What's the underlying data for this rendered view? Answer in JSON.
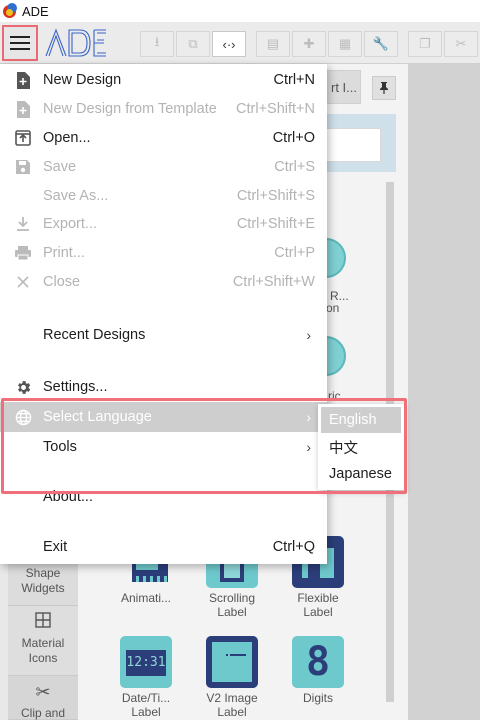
{
  "app": {
    "title": "ADE"
  },
  "toolbar": {
    "menu_icon": "hamburger-icon",
    "logo_text": "ADE",
    "buttons": [
      {
        "name": "download-icon",
        "glyph": "⭳"
      },
      {
        "name": "preview-icon",
        "glyph": "⧉"
      },
      {
        "name": "code-icon",
        "glyph": "‹·›"
      },
      {
        "name": "layers-icon",
        "glyph": "▤"
      },
      {
        "name": "puzzle-icon",
        "glyph": "✚"
      },
      {
        "name": "grid-icon",
        "glyph": "▦"
      },
      {
        "name": "wrench-icon",
        "glyph": "🔧"
      },
      {
        "name": "copy-icon",
        "glyph": "❐"
      },
      {
        "name": "scissors-icon",
        "glyph": "✂"
      }
    ]
  },
  "panel": {
    "tab_label": "rt I...",
    "pin_icon": "pin-icon"
  },
  "menu": {
    "items": [
      {
        "label": "New Design",
        "shortcut": "Ctrl+N",
        "icon": "new-file-icon",
        "enabled": true
      },
      {
        "label": "New Design from Template",
        "shortcut": "Ctrl+Shift+N",
        "icon": "template-icon",
        "enabled": false
      },
      {
        "label": "Open...",
        "shortcut": "Ctrl+O",
        "icon": "open-icon",
        "enabled": true
      },
      {
        "label": "Save",
        "shortcut": "Ctrl+S",
        "icon": "save-icon",
        "enabled": false
      },
      {
        "label": "Save As...",
        "shortcut": "Ctrl+Shift+S",
        "icon": "",
        "enabled": false
      },
      {
        "label": "Export...",
        "shortcut": "Ctrl+Shift+E",
        "icon": "export-icon",
        "enabled": false
      },
      {
        "label": "Print...",
        "shortcut": "Ctrl+P",
        "icon": "print-icon",
        "enabled": false
      },
      {
        "label": "Close",
        "shortcut": "Ctrl+Shift+W",
        "icon": "close-icon",
        "enabled": false
      },
      {
        "label": "Recent Designs",
        "shortcut": "",
        "icon": "",
        "enabled": true,
        "submenu": true
      },
      {
        "label": "Settings...",
        "shortcut": "",
        "icon": "gear-icon",
        "enabled": true
      },
      {
        "label": "Select Language",
        "shortcut": "",
        "icon": "globe-icon",
        "enabled": true,
        "submenu": true,
        "highlighted": true
      },
      {
        "label": "Tools",
        "shortcut": "",
        "icon": "",
        "enabled": true,
        "submenu": true
      },
      {
        "label": "About...",
        "shortcut": "",
        "icon": "",
        "enabled": true
      },
      {
        "label": "Exit",
        "shortcut": "Ctrl+Q",
        "icon": "",
        "enabled": true
      }
    ]
  },
  "language_menu": {
    "options": [
      "English",
      "中文",
      "Japanese"
    ],
    "selected": "English"
  },
  "categories": [
    {
      "label_line1": "Shape",
      "label_line2": "Widgets",
      "icon": "shape-icon"
    },
    {
      "label_line1": "Material",
      "label_line2": "Icons",
      "icon": "material-grid-icon"
    },
    {
      "label_line1": "Clip and",
      "label_line2": "",
      "icon": "scissors-icon"
    }
  ],
  "peek_labels": {
    "a": "R...",
    "b": "on",
    "c": "ric"
  },
  "widgets": [
    {
      "label_line1": "Animati...",
      "label_line2": "",
      "icon": "animation-widget-icon"
    },
    {
      "label_line1": "Scrolling",
      "label_line2": "Label",
      "icon": "scrolling-label-icon"
    },
    {
      "label_line1": "Flexible",
      "label_line2": "Label",
      "icon": "flexible-label-icon"
    },
    {
      "label_line1": "Date/Ti...",
      "label_line2": "Label",
      "icon": "datetime-label-icon",
      "display": "12:31"
    },
    {
      "label_line1": "V2 Image",
      "label_line2": "Label",
      "icon": "image-label-icon"
    },
    {
      "label_line1": "Digits",
      "label_line2": "",
      "icon": "digits-icon",
      "display": "8"
    }
  ]
}
